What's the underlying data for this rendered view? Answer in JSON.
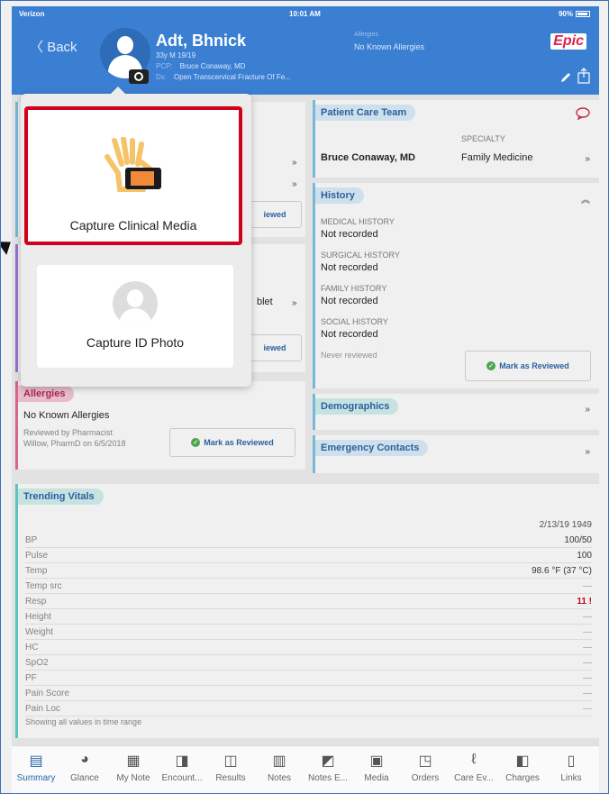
{
  "status": {
    "carrier": "Verizon",
    "time": "10:01 AM",
    "battery": "90%"
  },
  "header": {
    "back_label": "Back",
    "patient_name": "Adt, Bhnick",
    "age_line": "33y M  19/19",
    "pcp_label": "PCP:",
    "pcp_value": "Bruce Conaway, MD",
    "dx_label": "Dx:",
    "dx_value": "Open Transcervical Fracture Of Fe...",
    "allergies_label": "Allergies",
    "allergies_value": "No Known Allergies",
    "brand": "Epic"
  },
  "popup": {
    "capture_media_label": "Capture Clinical Media",
    "capture_id_label": "Capture ID Photo"
  },
  "left_partial": {
    "reviewed_1": "iewed",
    "oblet": "blet",
    "reviewed_2": "iewed"
  },
  "allergies_card": {
    "title": "Allergies",
    "value": "No Known Allergies",
    "reviewed_line1": "Reviewed by Pharmacist",
    "reviewed_line2": "Willow, PharmD on 6/5/2018",
    "button": "Mark as Reviewed"
  },
  "care_team": {
    "title": "Patient Care Team",
    "specialty_header": "SPECIALTY",
    "provider": "Bruce Conaway, MD",
    "specialty": "Family Medicine"
  },
  "history": {
    "title": "History",
    "sections": [
      {
        "label": "MEDICAL HISTORY",
        "value": "Not recorded"
      },
      {
        "label": "SURGICAL HISTORY",
        "value": "Not recorded"
      },
      {
        "label": "FAMILY HISTORY",
        "value": "Not recorded"
      },
      {
        "label": "SOCIAL HISTORY",
        "value": "Not recorded"
      }
    ],
    "footer": "Never reviewed",
    "button": "Mark as Reviewed"
  },
  "demographics": {
    "title": "Demographics"
  },
  "emergency": {
    "title": "Emergency Contacts"
  },
  "vitals": {
    "title": "Trending Vitals",
    "date": "2/13/19 1949",
    "rows": [
      {
        "label": "BP",
        "value": "100/50"
      },
      {
        "label": "Pulse",
        "value": "100"
      },
      {
        "label": "Temp",
        "value": "98.6 °F (37 °C)"
      },
      {
        "label": "Temp src",
        "value": "—"
      },
      {
        "label": "Resp",
        "value": "11 !"
      },
      {
        "label": "Height",
        "value": "—"
      },
      {
        "label": "Weight",
        "value": "—"
      },
      {
        "label": "HC",
        "value": "—"
      },
      {
        "label": "SpO2",
        "value": "—"
      },
      {
        "label": "PF",
        "value": "—"
      },
      {
        "label": "Pain Score",
        "value": "—"
      },
      {
        "label": "Pain Loc",
        "value": "—"
      }
    ],
    "footer": "Showing all values in time range"
  },
  "tabs": [
    {
      "label": "Summary",
      "icon": "summary-icon"
    },
    {
      "label": "Glance",
      "icon": "glance-icon"
    },
    {
      "label": "My Note",
      "icon": "note-icon"
    },
    {
      "label": "Encount...",
      "icon": "encounter-icon"
    },
    {
      "label": "Results",
      "icon": "results-icon"
    },
    {
      "label": "Notes",
      "icon": "notes-icon"
    },
    {
      "label": "Notes E...",
      "icon": "notes-edit-icon"
    },
    {
      "label": "Media",
      "icon": "media-icon"
    },
    {
      "label": "Orders",
      "icon": "orders-icon"
    },
    {
      "label": "Care Ev...",
      "icon": "care-everywhere-icon"
    },
    {
      "label": "Charges",
      "icon": "charges-icon"
    },
    {
      "label": "Links",
      "icon": "links-icon"
    }
  ],
  "colors": {
    "header": "#3b7fd3",
    "accent": "#2a63a8",
    "highlight": "#d0021b"
  }
}
